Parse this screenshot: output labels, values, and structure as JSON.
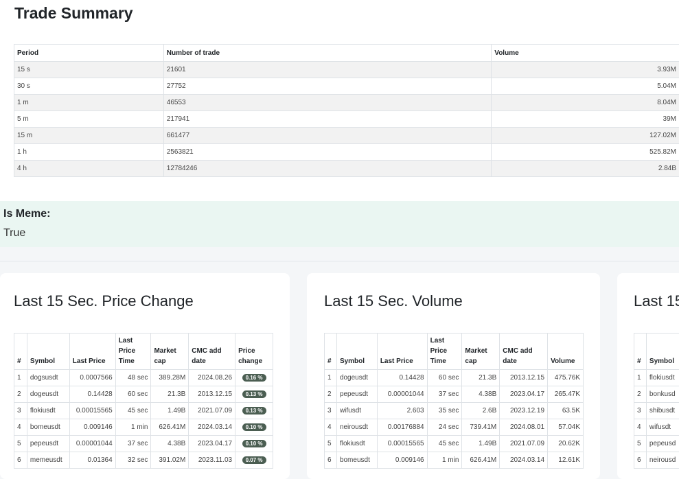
{
  "trade_summary": {
    "title": "Trade Summary",
    "headers": [
      "Period",
      "Number of trade",
      "Volume"
    ],
    "rows": [
      {
        "period": "15 s",
        "trades": "21601",
        "volume": "3.93M"
      },
      {
        "period": "30 s",
        "trades": "27752",
        "volume": "5.04M"
      },
      {
        "period": "1 m",
        "trades": "46553",
        "volume": "8.04M"
      },
      {
        "period": "5 m",
        "trades": "217941",
        "volume": "39M"
      },
      {
        "period": "15 m",
        "trades": "661477",
        "volume": "127.02M"
      },
      {
        "period": "1 h",
        "trades": "2563821",
        "volume": "525.82M"
      },
      {
        "period": "4 h",
        "trades": "12784246",
        "volume": "2.84B"
      }
    ]
  },
  "meme": {
    "label": "Is Meme:",
    "value": "True"
  },
  "cards": {
    "price_change": {
      "title": "Last 15 Sec. Price Change",
      "headers": {
        "num": "#",
        "symbol": "Symbol",
        "last_price": "Last Price",
        "time": "Last Price Time",
        "mcap": "Market cap",
        "cmc": "CMC add date",
        "extra": "Price change"
      },
      "rows": [
        {
          "n": "1",
          "symbol": "dogsusdt",
          "price": "0.0007566",
          "time": "48 sec",
          "mcap": "389.28M",
          "cmc": "2024.08.26",
          "change": "0.16 %"
        },
        {
          "n": "2",
          "symbol": "dogeusdt",
          "price": "0.14428",
          "time": "60 sec",
          "mcap": "21.3B",
          "cmc": "2013.12.15",
          "change": "0.13 %"
        },
        {
          "n": "3",
          "symbol": "flokiusdt",
          "price": "0.00015565",
          "time": "45 sec",
          "mcap": "1.49B",
          "cmc": "2021.07.09",
          "change": "0.13 %"
        },
        {
          "n": "4",
          "symbol": "bomeusdt",
          "price": "0.009146",
          "time": "1 min",
          "mcap": "626.41M",
          "cmc": "2024.03.14",
          "change": "0.10 %"
        },
        {
          "n": "5",
          "symbol": "pepeusdt",
          "price": "0.00001044",
          "time": "37 sec",
          "mcap": "4.38B",
          "cmc": "2023.04.17",
          "change": "0.10 %"
        },
        {
          "n": "6",
          "symbol": "memeusdt",
          "price": "0.01364",
          "time": "32 sec",
          "mcap": "391.02M",
          "cmc": "2023.11.03",
          "change": "0.07 %"
        }
      ]
    },
    "volume": {
      "title": "Last 15 Sec. Volume",
      "headers": {
        "num": "#",
        "symbol": "Symbol",
        "last_price": "Last Price",
        "time": "Last Price Time",
        "mcap": "Market cap",
        "cmc": "CMC add date",
        "extra": "Volume"
      },
      "rows": [
        {
          "n": "1",
          "symbol": "dogeusdt",
          "price": "0.14428",
          "time": "60 sec",
          "mcap": "21.3B",
          "cmc": "2013.12.15",
          "volume": "475.76K"
        },
        {
          "n": "2",
          "symbol": "pepeusdt",
          "price": "0.00001044",
          "time": "37 sec",
          "mcap": "4.38B",
          "cmc": "2023.04.17",
          "volume": "265.47K"
        },
        {
          "n": "3",
          "symbol": "wifusdt",
          "price": "2.603",
          "time": "35 sec",
          "mcap": "2.6B",
          "cmc": "2023.12.19",
          "volume": "63.5K"
        },
        {
          "n": "4",
          "symbol": "neirousdt",
          "price": "0.00176884",
          "time": "24 sec",
          "mcap": "739.41M",
          "cmc": "2024.08.01",
          "volume": "57.04K"
        },
        {
          "n": "5",
          "symbol": "flokiusdt",
          "price": "0.00015565",
          "time": "45 sec",
          "mcap": "1.49B",
          "cmc": "2021.07.09",
          "volume": "20.62K"
        },
        {
          "n": "6",
          "symbol": "bomeusdt",
          "price": "0.009146",
          "time": "1 min",
          "mcap": "626.41M",
          "cmc": "2024.03.14",
          "volume": "12.61K"
        }
      ]
    },
    "third": {
      "title": "Last 15",
      "headers": {
        "num": "#",
        "symbol": "Symbol"
      },
      "rows": [
        {
          "n": "1",
          "symbol": "flokiusdt"
        },
        {
          "n": "2",
          "symbol": "bonkusd"
        },
        {
          "n": "3",
          "symbol": "shibusdt"
        },
        {
          "n": "4",
          "symbol": "wifusdt"
        },
        {
          "n": "5",
          "symbol": "pepeusd"
        },
        {
          "n": "6",
          "symbol": "neirousd"
        }
      ]
    }
  },
  "colors": {
    "badge": "#4b5e52",
    "meme_bg": "#eaf6f2",
    "page_bg": "#f4f6f8"
  }
}
